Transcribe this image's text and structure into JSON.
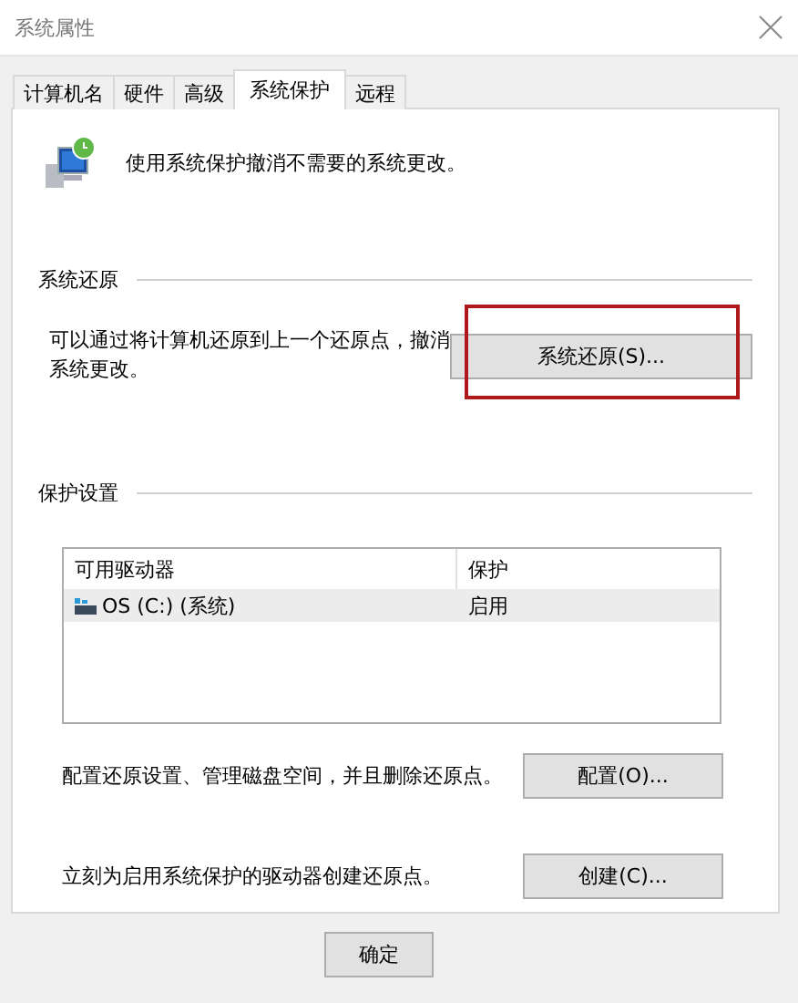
{
  "window": {
    "title": "系统属性"
  },
  "tabs": [
    {
      "label": "计算机名",
      "selected": false
    },
    {
      "label": "硬件",
      "selected": false
    },
    {
      "label": "高级",
      "selected": false
    },
    {
      "label": "系统保护",
      "selected": true
    },
    {
      "label": "远程",
      "selected": false
    }
  ],
  "intro": "使用系统保护撤消不需要的系统更改。",
  "restore_section": {
    "heading": "系统还原",
    "description": "可以通过将计算机还原到上一个还原点，撤消系统更改。",
    "button": "系统还原(S)...",
    "highlighted": true
  },
  "protection_section": {
    "heading": "保护设置",
    "table": {
      "columns": [
        "可用驱动器",
        "保护"
      ],
      "rows": [
        {
          "drive": "OS (C:) (系统)",
          "protection": "启用",
          "selected": true
        }
      ]
    },
    "actions": [
      {
        "text": "配置还原设置、管理磁盘空间，并且删除还原点。",
        "button": "配置(O)..."
      },
      {
        "text": "立刻为启用系统保护的驱动器创建还原点。",
        "button": "创建(C)..."
      }
    ]
  },
  "buttons": [
    "确定"
  ]
}
